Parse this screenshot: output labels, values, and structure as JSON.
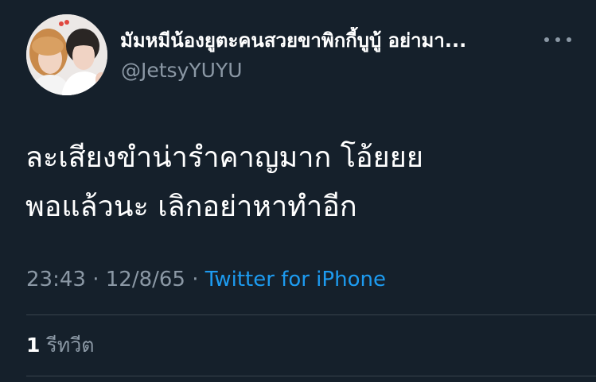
{
  "tweet": {
    "display_name": "มัมหมีน้องยูตะคนสวยขาพิกกี้บูบู้ อย่ามา...",
    "handle": "@JetsyYUYU",
    "more_icon": "more-horizontal-icon",
    "text_lines": [
      "ละเสียงขำน่ารำคาญมาก โอ้ยยย",
      "พอแล้วนะ เลิกอย่าหาทำอีก"
    ],
    "time": "23:43",
    "separator": " · ",
    "date": "12/8/65",
    "source": "Twitter for iPhone",
    "retweet_count": "1",
    "retweet_label": " รีทวีต"
  },
  "colors": {
    "background": "#15202b",
    "text_primary": "#ffffff",
    "text_secondary": "#8b98a5",
    "link": "#1d9bf0",
    "divider": "#38444d"
  }
}
